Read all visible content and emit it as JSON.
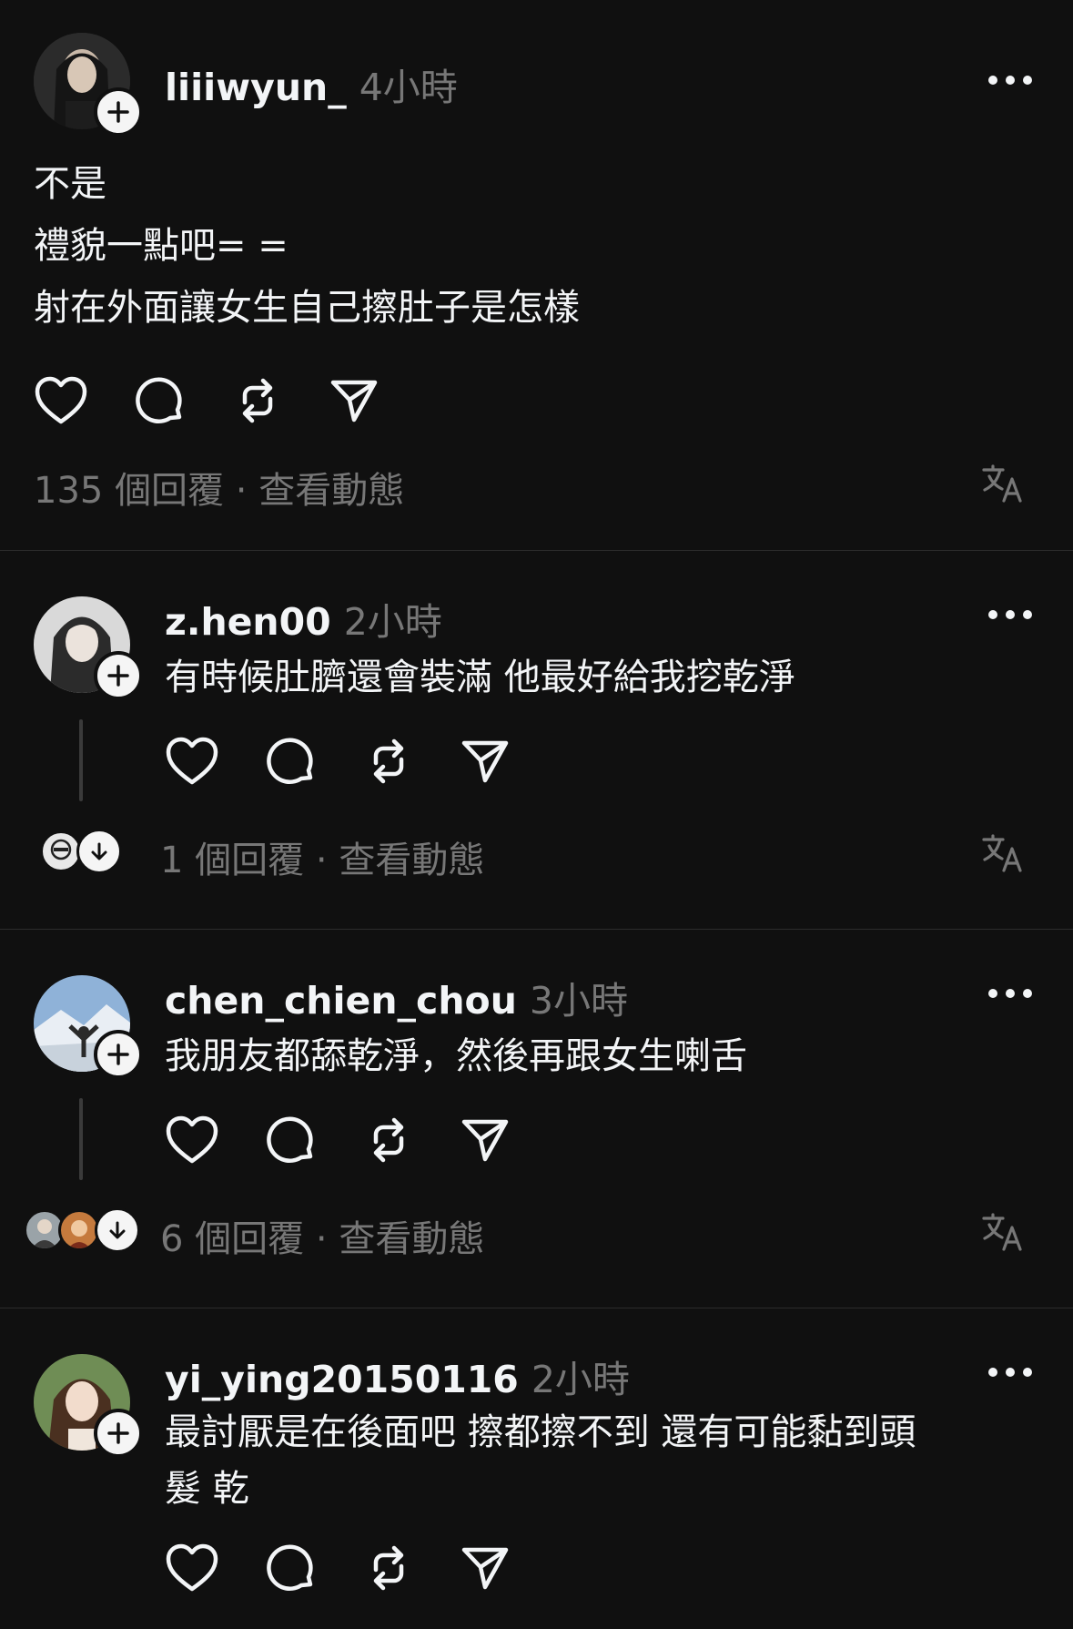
{
  "posts": [
    {
      "username": "liiiwyun_",
      "time": "4小時",
      "text": "不是\n禮貌一點吧= =\n射在外面讓女生自己擦肚子是怎樣",
      "replies": "135 個回覆",
      "activity": "查看動態"
    },
    {
      "username": "z.hen00",
      "time": "2小時",
      "text": "有時候肚臍還會裝滿 他最好給我挖乾淨",
      "replies": "1 個回覆",
      "activity": "查看動態"
    },
    {
      "username": "chen_chien_chou",
      "time": "3小時",
      "text": "我朋友都舔乾淨，然後再跟女生喇舌",
      "replies": "6 個回覆",
      "activity": "查看動態"
    },
    {
      "username": "yi_ying20150116",
      "time": "2小時",
      "text": "最討厭是在後面吧 擦都擦不到 還有可能黏到頭\n髮 乾"
    }
  ],
  "separator": "·",
  "icons": [
    "heart-icon",
    "comment-icon",
    "repost-icon",
    "share-icon",
    "translate-icon",
    "more-icon",
    "follow-plus-icon",
    "expand-down-icon"
  ]
}
